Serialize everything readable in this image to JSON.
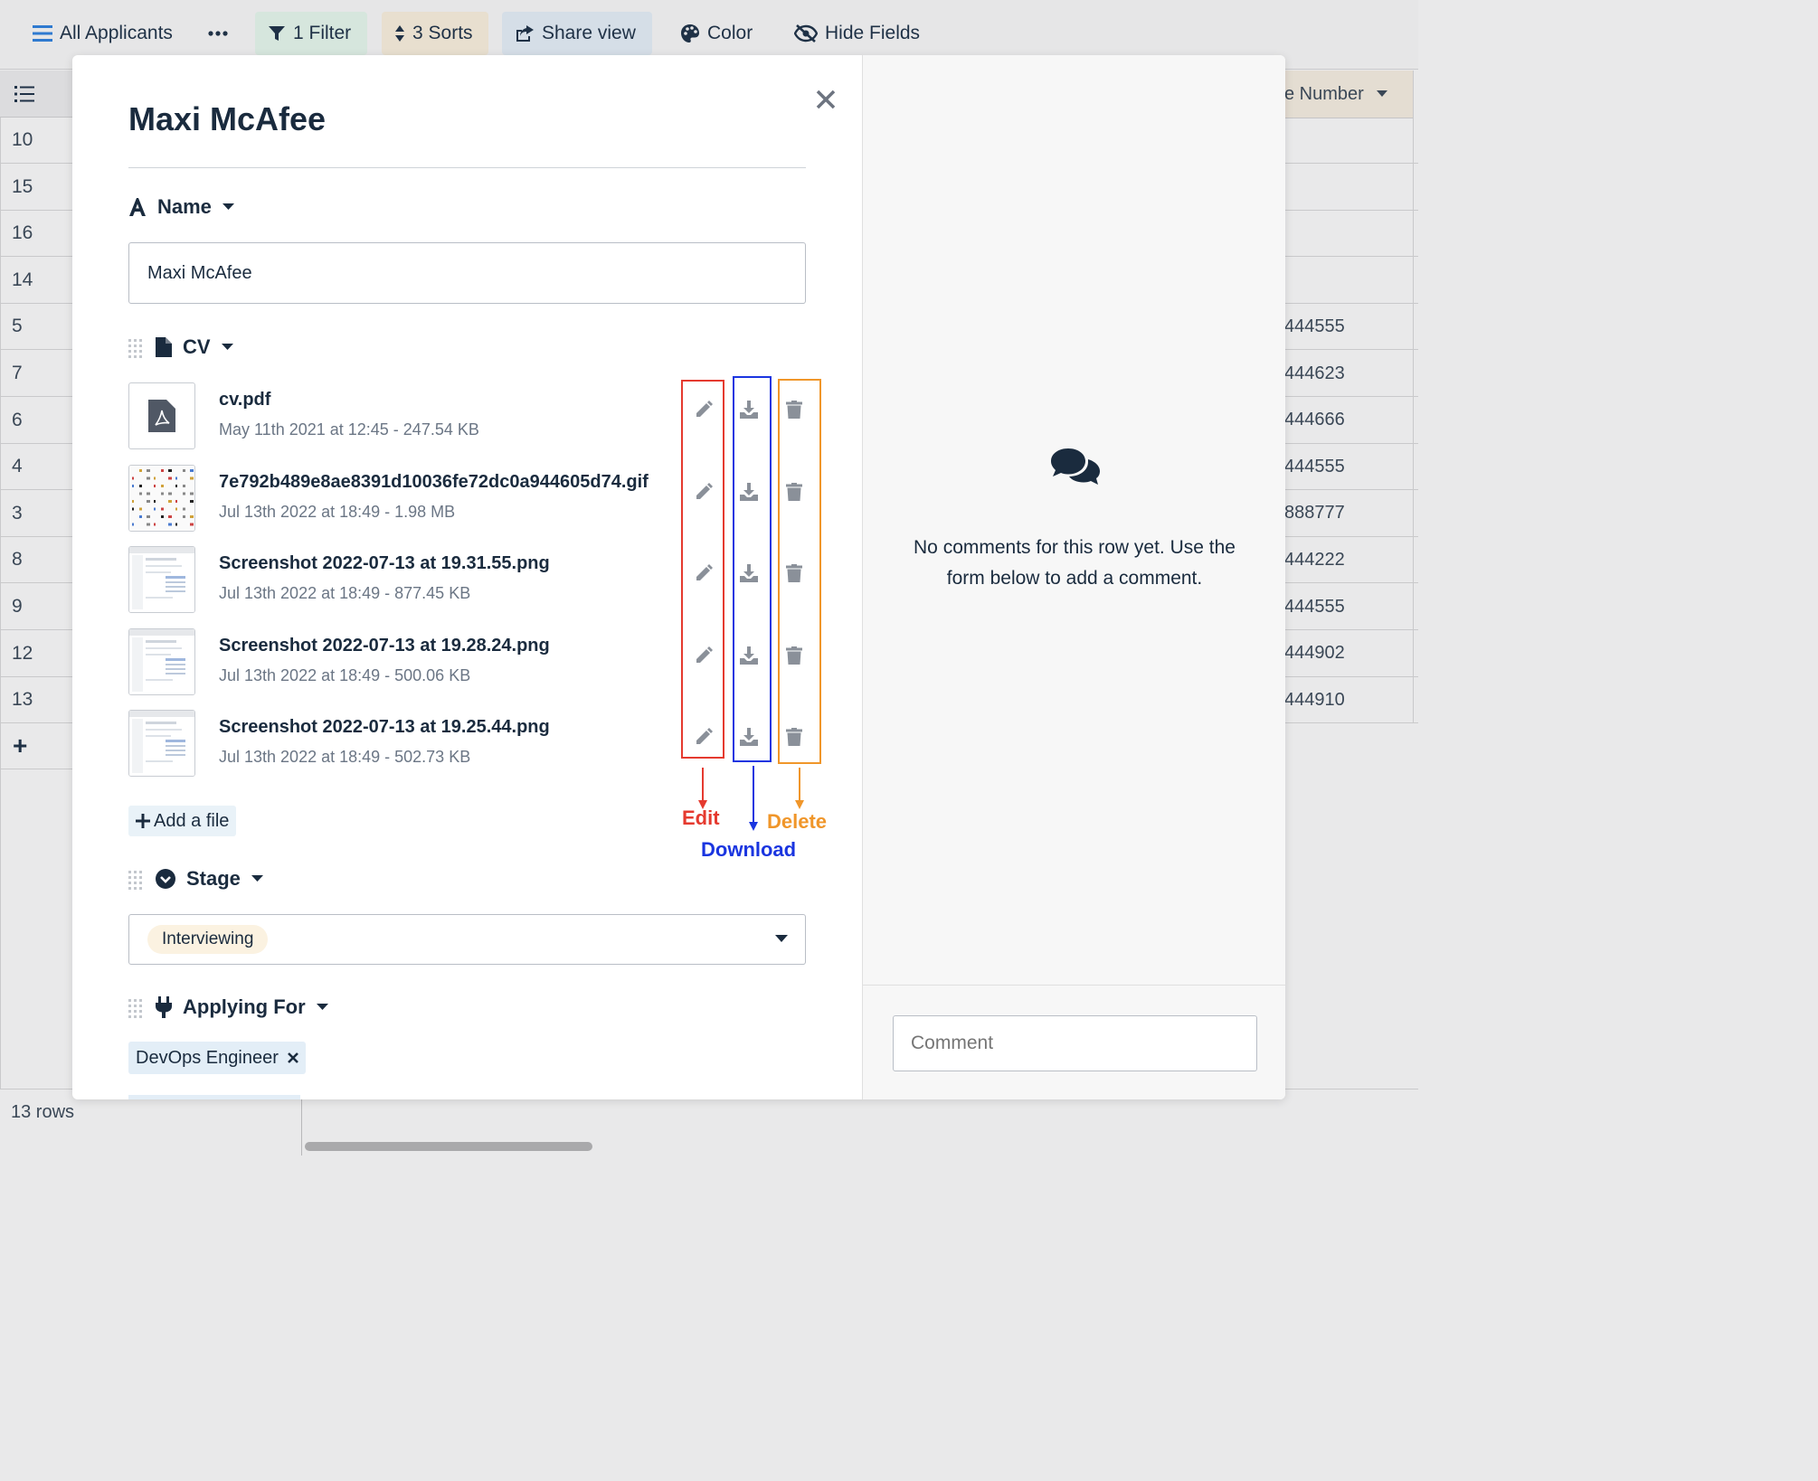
{
  "toolbar": {
    "view_name": "All Applicants",
    "filter_label": "1 Filter",
    "sorts_label": "3 Sorts",
    "share_label": "Share view",
    "color_label": "Color",
    "hide_label": "Hide Fields"
  },
  "grid": {
    "row_ids": [
      "10",
      "15",
      "16",
      "14",
      "5",
      "7",
      "6",
      "4",
      "3",
      "8",
      "9",
      "12",
      "13"
    ],
    "phone_header": "e Number",
    "phone_values": [
      "",
      "",
      "",
      "",
      "444555",
      "444623",
      "444666",
      "444555",
      "888777",
      "444222",
      "444555",
      "444902",
      "444910"
    ],
    "row_count": "13 rows"
  },
  "modal": {
    "title": "Maxi McAfee",
    "fields": {
      "name": {
        "label": "Name",
        "value": "Maxi McAfee"
      },
      "cv": {
        "label": "CV"
      },
      "stage": {
        "label": "Stage",
        "value": "Interviewing"
      },
      "applying_for": {
        "label": "Applying For",
        "value": "DevOps Engineer"
      }
    },
    "files": [
      {
        "name": "cv.pdf",
        "meta": "May 11th 2021 at 12:45 - 247.54 KB",
        "thumb": "pdf-icon"
      },
      {
        "name": "7e792b489e8ae8391d10036fe72dc0a944605d74.gif",
        "meta": "Jul 13th 2022 at 18:49 - 1.98 MB",
        "thumb": "image-thumbnail"
      },
      {
        "name": "Screenshot 2022-07-13 at 19.31.55.png",
        "meta": "Jul 13th 2022 at 18:49 - 877.45 KB",
        "thumb": "image-thumbnail"
      },
      {
        "name": "Screenshot 2022-07-13 at 19.28.24.png",
        "meta": "Jul 13th 2022 at 18:49 - 500.06 KB",
        "thumb": "image-thumbnail"
      },
      {
        "name": "Screenshot 2022-07-13 at 19.25.44.png",
        "meta": "Jul 13th 2022 at 18:49 - 502.73 KB",
        "thumb": "image-thumbnail"
      }
    ],
    "add_file_label": "Add a file",
    "annotations": {
      "edit": "Edit",
      "download": "Download",
      "delete": "Delete",
      "colors": {
        "edit": "#e53a2f",
        "download": "#1a35e0",
        "delete": "#f0962a"
      }
    }
  },
  "comments": {
    "empty_text": "No comments for this row yet. Use the form below to add a comment.",
    "placeholder": "Comment"
  },
  "colors": {
    "text": "#1a2b3e",
    "muted": "#6b7685",
    "filter_bg": "#d6e6dd",
    "sorts_bg": "#e8dfcf",
    "share_bg": "#d5dee7"
  }
}
